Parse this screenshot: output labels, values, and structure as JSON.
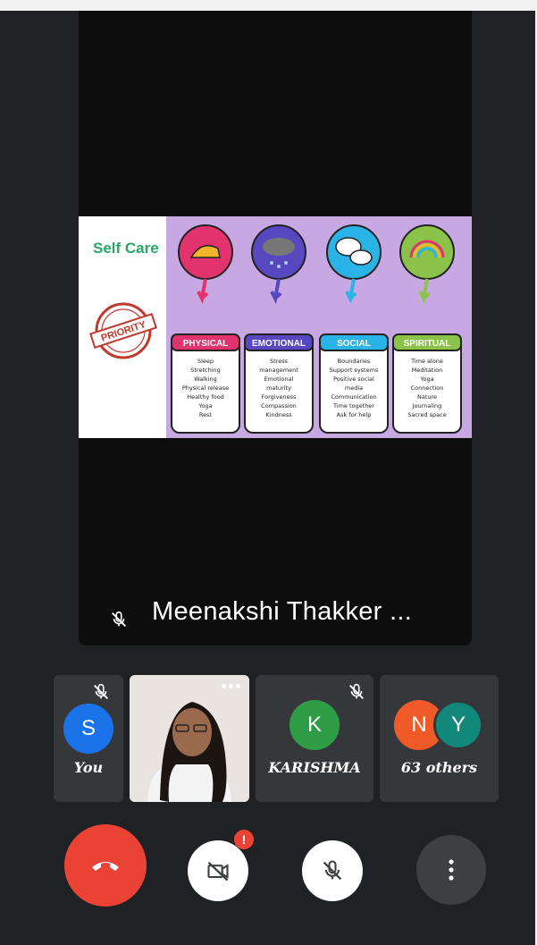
{
  "presentation": {
    "slide_title": "Self Care",
    "stamp_text": "PRIORITY",
    "categories": [
      {
        "label": "PHYSICAL",
        "color": "#e3336e",
        "items": [
          "Sleep",
          "Stretching",
          "Walking",
          "Physical release",
          "Healthy food",
          "Yoga",
          "Rest"
        ]
      },
      {
        "label": "EMOTIONAL",
        "color": "#5848c0",
        "items": [
          "Stress",
          "management",
          "Emotional",
          "maturity",
          "Forgiveness",
          "Compassion",
          "Kindness"
        ]
      },
      {
        "label": "SOCIAL",
        "color": "#2ab3e6",
        "items": [
          "Boundaries",
          "Support systems",
          "Positive social",
          "media",
          "Communication",
          "Time together",
          "Ask for help"
        ]
      },
      {
        "label": "SPIRITUAL",
        "color": "#8bc34a",
        "items": [
          "Time alone",
          "Meditation",
          "Yoga",
          "Connection",
          "Nature",
          "Journaling",
          "Sacred space"
        ]
      }
    ]
  },
  "speaker": {
    "name": "Meenakshi Thakker ...",
    "muted_icon": "mic-off-icon"
  },
  "participants": [
    {
      "initial": "S",
      "label": "You",
      "avatar_color": "#1a73e8",
      "muted": true
    },
    {
      "type": "video",
      "label": "",
      "more_icon": "more-horiz-icon"
    },
    {
      "initial": "K",
      "label": "KARISHMA",
      "avatar_color": "#2e9d46",
      "muted": true
    },
    {
      "initials": [
        "N",
        "Y"
      ],
      "label": "63 others",
      "avatar_colors": [
        "#f05a28",
        "#11887a"
      ]
    }
  ],
  "controls": {
    "end_call_color": "#ea4335",
    "camera_badge": "!",
    "icons": [
      "end-call-icon",
      "camera-off-icon",
      "mic-off-icon",
      "more-vert-icon"
    ]
  }
}
